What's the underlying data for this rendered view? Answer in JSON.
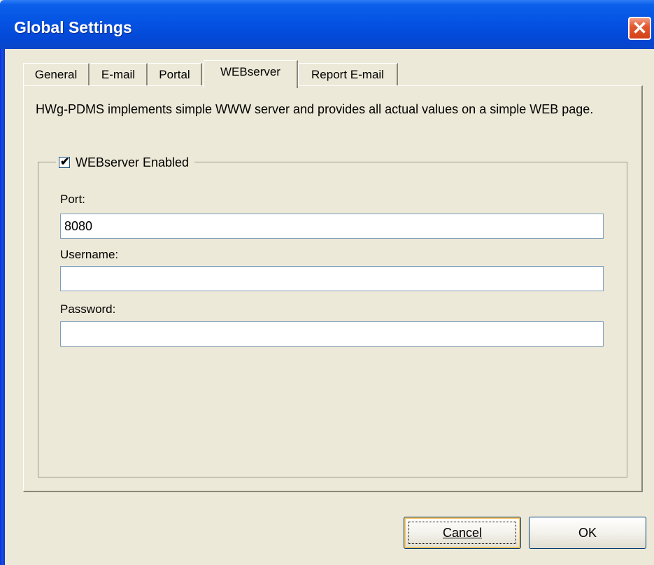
{
  "window": {
    "title": "Global Settings"
  },
  "tabs": [
    {
      "label": "General"
    },
    {
      "label": "E-mail"
    },
    {
      "label": "Portal"
    },
    {
      "label": "WEBserver",
      "active": true
    },
    {
      "label": "Report E-mail"
    }
  ],
  "panel": {
    "description": "HWg-PDMS implements simple WWW server and provides all actual values on a simple WEB page.",
    "webserver_enabled": {
      "label": "WEBserver Enabled",
      "checked": true
    },
    "port": {
      "label": "Port:",
      "value": "8080"
    },
    "username": {
      "label": "Username:",
      "value": ""
    },
    "password": {
      "label": "Password:",
      "value": ""
    }
  },
  "buttons": {
    "cancel": "Cancel",
    "ok": "OK"
  },
  "colors": {
    "titlebar": "#0553e3",
    "dialog_bg": "#ECE9D8",
    "close": "#e3582f"
  }
}
